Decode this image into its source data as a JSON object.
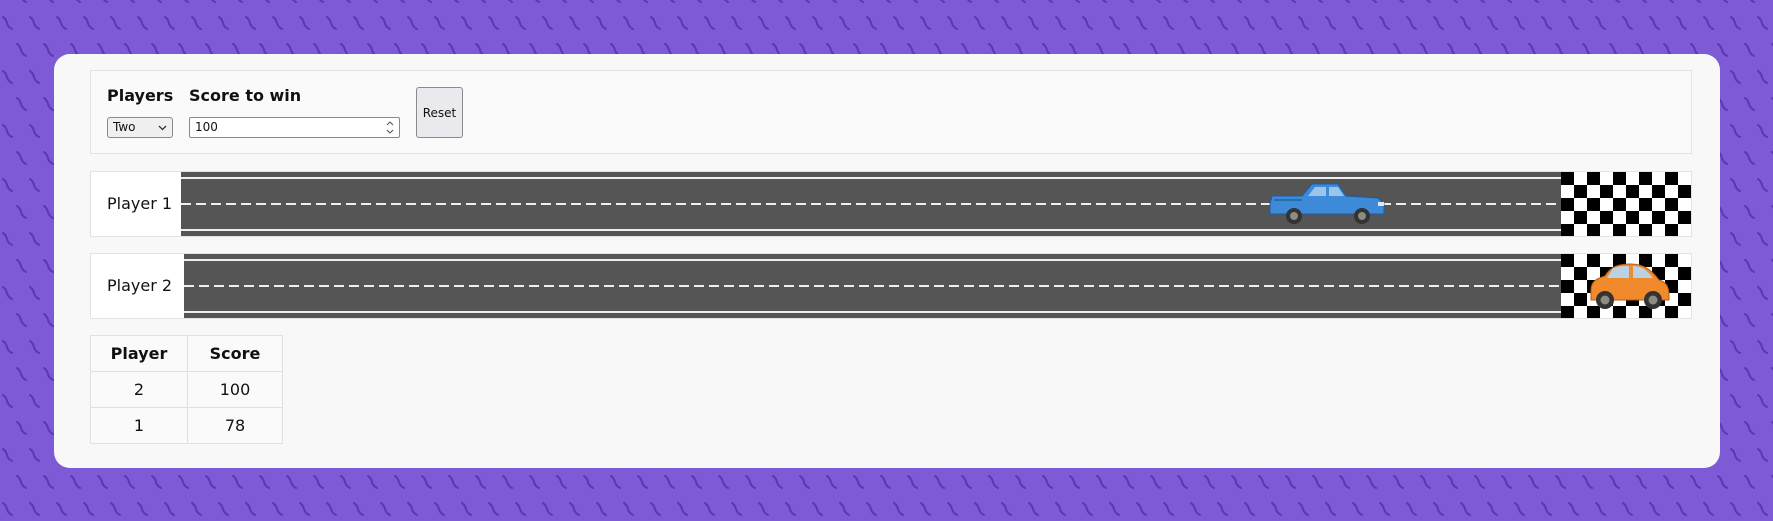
{
  "controls": {
    "players_label": "Players",
    "players_value": "Two",
    "score_to_win_label": "Score to win",
    "score_to_win_value": "100",
    "reset_label": "Reset"
  },
  "lanes": [
    {
      "label": "Player 1",
      "car": "blue-pickup-truck",
      "car_color": "#3d8ad8",
      "score": 78
    },
    {
      "label": "Player 2",
      "car": "orange-compact-car",
      "car_color": "#f08a2c",
      "score": 100
    }
  ],
  "scoreboard": {
    "headers": [
      "Player",
      "Score"
    ],
    "rows": [
      {
        "player": "2",
        "score": "100"
      },
      {
        "player": "1",
        "score": "78"
      }
    ]
  },
  "colors": {
    "background": "#7e5ad6",
    "pattern": "#5a38b0",
    "road": "#555555"
  }
}
